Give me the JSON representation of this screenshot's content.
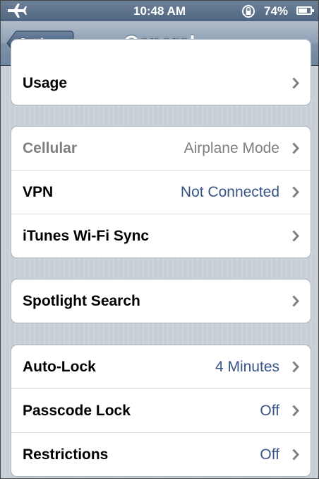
{
  "status_bar": {
    "time": "10:48 AM",
    "battery_pct": "74%",
    "battery_level": 0.74
  },
  "nav": {
    "back_label": "Settings",
    "title": "General"
  },
  "groups": [
    {
      "rows": [
        {
          "label": "Usage",
          "value": ""
        }
      ]
    },
    {
      "rows": [
        {
          "label": "Cellular",
          "value": "Airplane Mode"
        },
        {
          "label": "VPN",
          "value": "Not Connected"
        },
        {
          "label": "iTunes Wi-Fi Sync",
          "value": ""
        }
      ]
    },
    {
      "rows": [
        {
          "label": "Spotlight Search",
          "value": ""
        }
      ]
    },
    {
      "rows": [
        {
          "label": "Auto-Lock",
          "value": "4 Minutes"
        },
        {
          "label": "Passcode Lock",
          "value": "Off"
        },
        {
          "label": "Restrictions",
          "value": "Off"
        }
      ]
    }
  ],
  "colors": {
    "accent_value": "#385487",
    "nav_bar": "#7e92aa",
    "background": "#c7ced6"
  }
}
